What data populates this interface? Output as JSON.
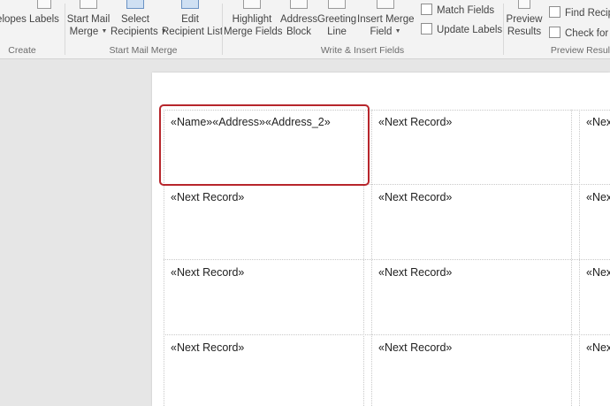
{
  "ribbon": {
    "create": {
      "envelopes_label": "elopes",
      "labels_label": "Labels",
      "group_label": "Create"
    },
    "start_mail_merge": {
      "start_line1": "Start Mail",
      "start_line2": "Merge",
      "select_line1": "Select",
      "select_line2": "Recipients",
      "edit_line1": "Edit",
      "edit_line2": "Recipient List",
      "group_label": "Start Mail Merge"
    },
    "write_insert": {
      "highlight_line1": "Highlight",
      "highlight_line2": "Merge Fields",
      "address_line1": "Address",
      "address_line2": "Block",
      "greeting_line1": "Greeting",
      "greeting_line2": "Line",
      "insert_line1": "Insert Merge",
      "insert_line2": "Field",
      "match_fields": "Match Fields",
      "update_labels": "Update Labels",
      "group_label": "Write & Insert Fields"
    },
    "preview": {
      "preview_line1": "Preview",
      "preview_line2": "Results",
      "find_recipient": "Find Recipie",
      "check_errors": "Check for E",
      "group_label": "Preview Resul"
    }
  },
  "document": {
    "first_cell": "«Name»«Address»«Address_2»",
    "next_record": "«Next Record»",
    "next_record_cut": "«Nex"
  }
}
